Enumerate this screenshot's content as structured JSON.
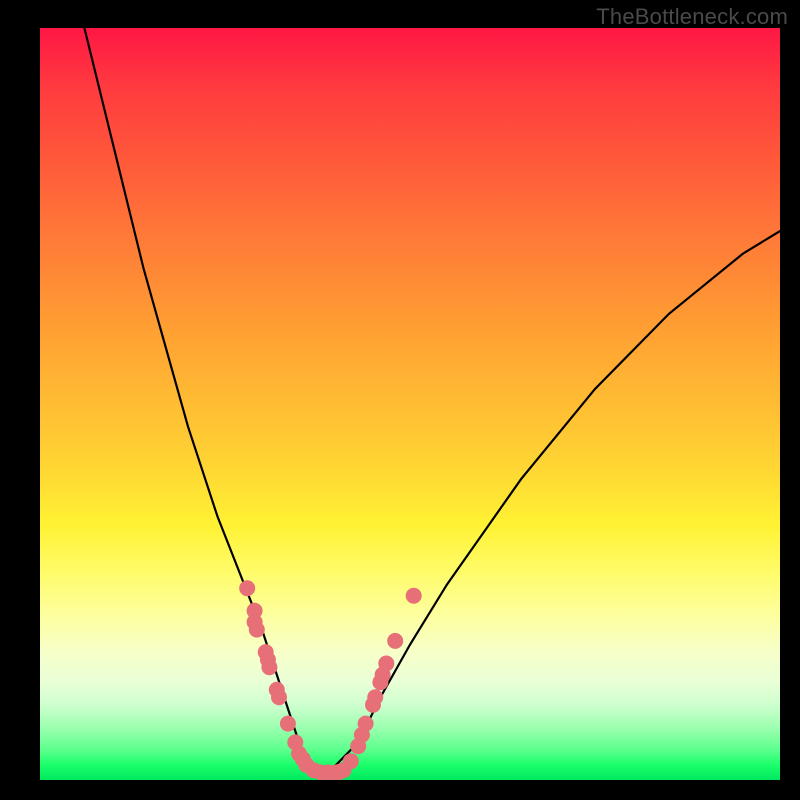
{
  "watermark": "TheBottleneck.com",
  "colors": {
    "curve_stroke": "#000000",
    "marker_fill": "#e76f78",
    "marker_stroke": "#d65a63"
  },
  "chart_data": {
    "type": "line",
    "title": "",
    "xlabel": "",
    "ylabel": "",
    "xlim": [
      0,
      100
    ],
    "ylim": [
      0,
      100
    ],
    "curve_left": {
      "x": [
        6,
        8,
        10,
        12,
        14,
        16,
        18,
        20,
        22,
        24,
        26,
        28,
        30,
        32,
        33,
        34,
        35,
        36,
        37,
        38
      ],
      "y_pct": [
        100,
        92,
        84,
        76,
        68,
        61,
        54,
        47,
        41,
        35,
        30,
        25,
        20,
        14,
        11,
        8,
        5,
        3,
        1.5,
        1
      ]
    },
    "curve_right": {
      "x": [
        38,
        40,
        42,
        44,
        46,
        50,
        55,
        60,
        65,
        70,
        75,
        80,
        85,
        90,
        95,
        100
      ],
      "y_pct": [
        1,
        2,
        4,
        7,
        11,
        18,
        26,
        33,
        40,
        46,
        52,
        57,
        62,
        66,
        70,
        73
      ]
    },
    "markers": [
      {
        "x": 28.0,
        "y_pct": 25.5
      },
      {
        "x": 29.0,
        "y_pct": 22.5
      },
      {
        "x": 29.0,
        "y_pct": 21.0
      },
      {
        "x": 29.3,
        "y_pct": 20.0
      },
      {
        "x": 30.5,
        "y_pct": 17.0
      },
      {
        "x": 30.8,
        "y_pct": 16.0
      },
      {
        "x": 31.0,
        "y_pct": 15.0
      },
      {
        "x": 32.0,
        "y_pct": 12.0
      },
      {
        "x": 32.3,
        "y_pct": 11.0
      },
      {
        "x": 33.5,
        "y_pct": 7.5
      },
      {
        "x": 34.5,
        "y_pct": 5.0
      },
      {
        "x": 35.0,
        "y_pct": 3.5
      },
      {
        "x": 35.5,
        "y_pct": 2.8
      },
      {
        "x": 36.0,
        "y_pct": 2.0
      },
      {
        "x": 37.0,
        "y_pct": 1.3
      },
      {
        "x": 38.0,
        "y_pct": 1.0
      },
      {
        "x": 39.0,
        "y_pct": 1.0
      },
      {
        "x": 40.0,
        "y_pct": 1.0
      },
      {
        "x": 40.5,
        "y_pct": 1.1
      },
      {
        "x": 41.0,
        "y_pct": 1.3
      },
      {
        "x": 42.0,
        "y_pct": 2.5
      },
      {
        "x": 43.0,
        "y_pct": 4.5
      },
      {
        "x": 43.5,
        "y_pct": 6.0
      },
      {
        "x": 44.0,
        "y_pct": 7.5
      },
      {
        "x": 45.0,
        "y_pct": 10.0
      },
      {
        "x": 45.3,
        "y_pct": 11.0
      },
      {
        "x": 46.0,
        "y_pct": 13.0
      },
      {
        "x": 46.3,
        "y_pct": 14.0
      },
      {
        "x": 46.8,
        "y_pct": 15.5
      },
      {
        "x": 48.0,
        "y_pct": 18.5
      },
      {
        "x": 50.5,
        "y_pct": 24.5
      }
    ]
  }
}
